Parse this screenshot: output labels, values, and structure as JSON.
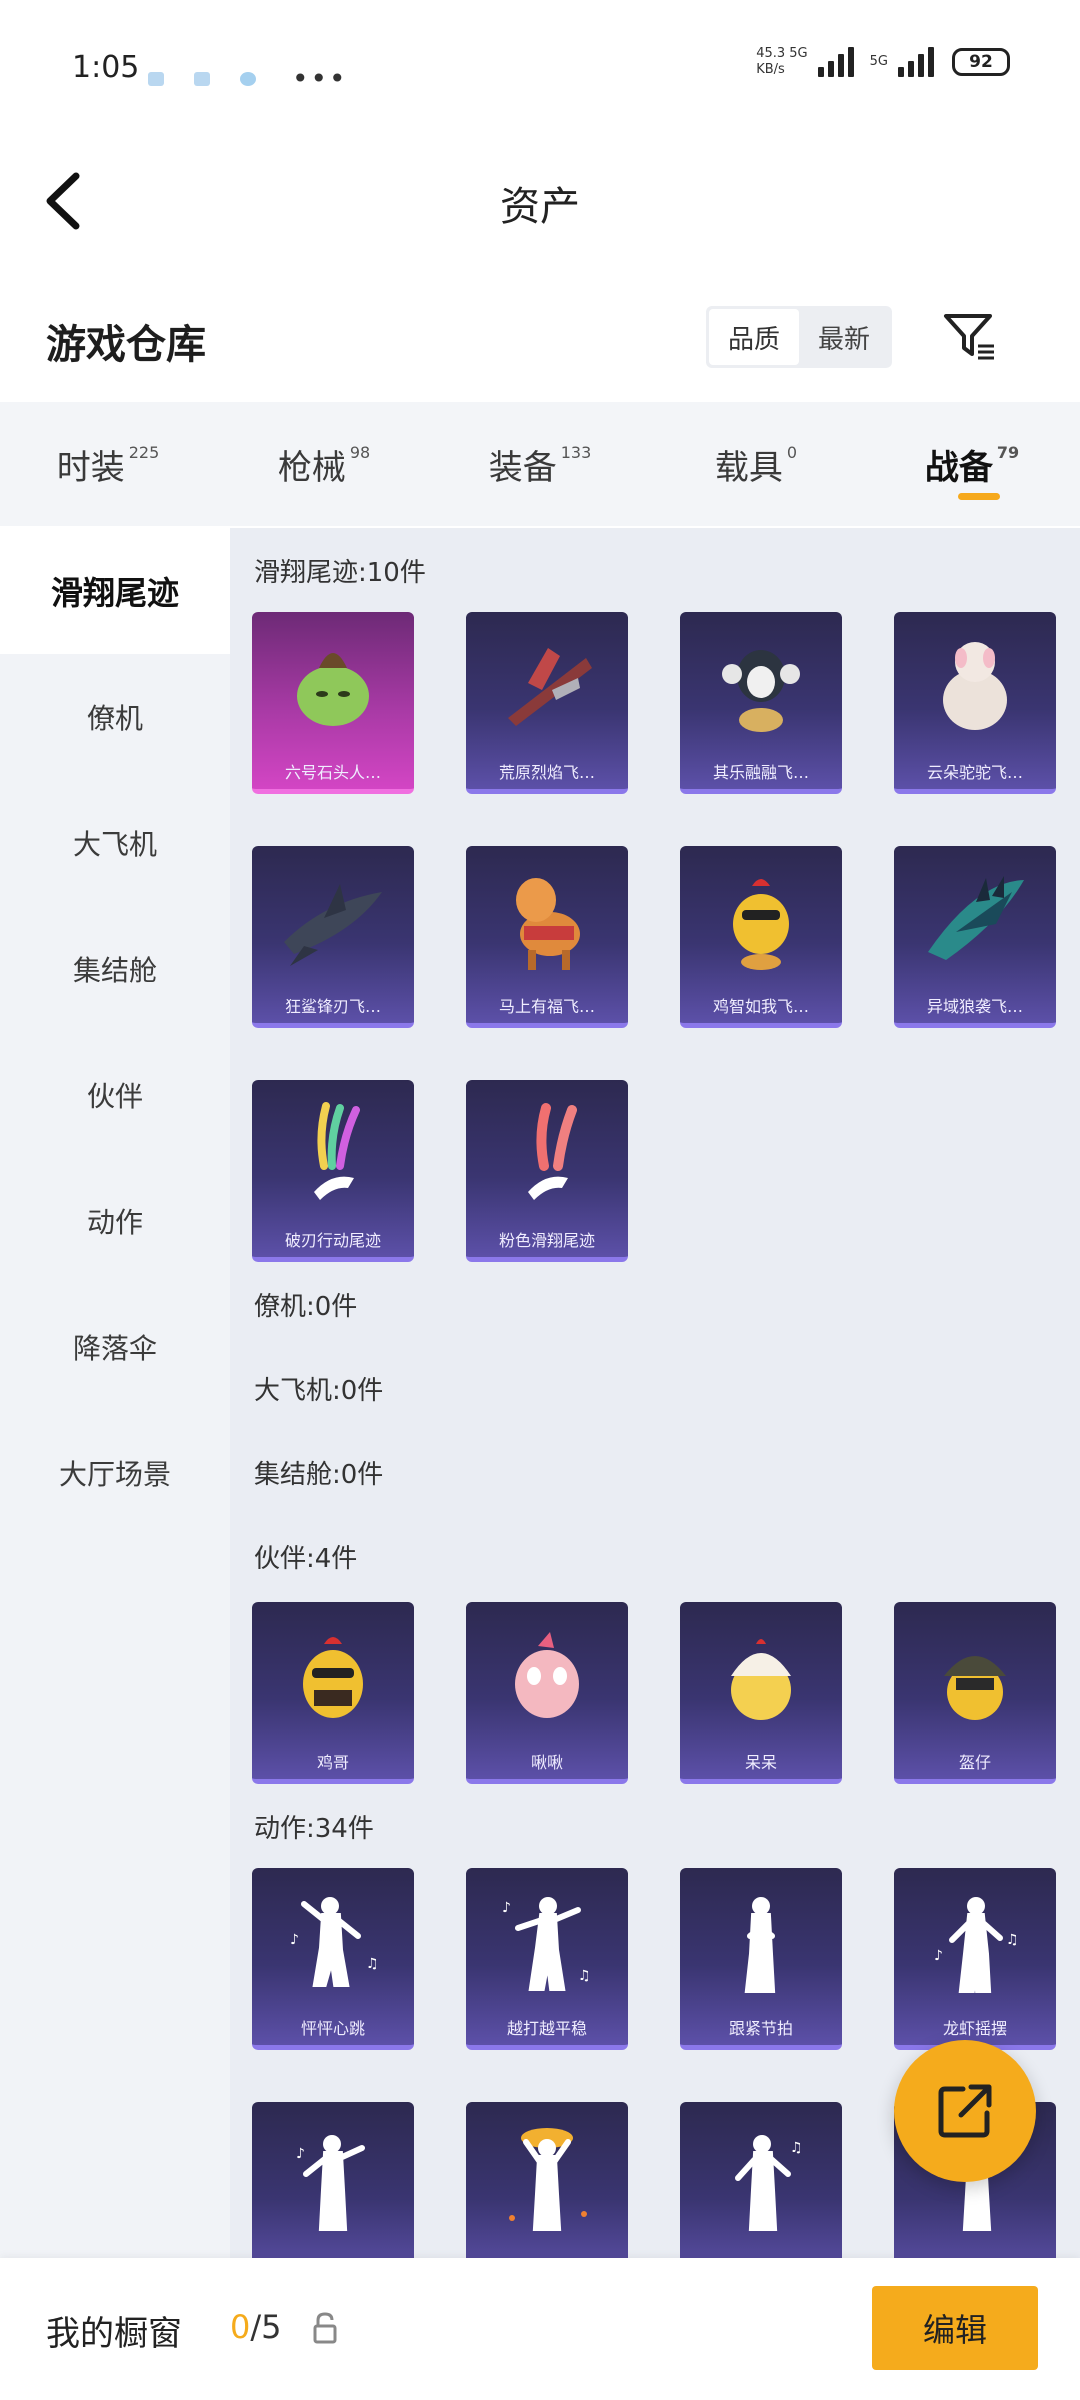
{
  "status_bar": {
    "time": "1:05",
    "speed_value": "45.3 5G",
    "speed_unit": "KB/s",
    "network": "5G",
    "battery": "92"
  },
  "header": {
    "title": "资产"
  },
  "warehouse": {
    "title": "游戏仓库",
    "sort_options": [
      "品质",
      "最新"
    ],
    "active_sort": "品质"
  },
  "tabs": [
    {
      "label": "时装",
      "count": "225"
    },
    {
      "label": "枪械",
      "count": "98"
    },
    {
      "label": "装备",
      "count": "133"
    },
    {
      "label": "载具",
      "count": "0"
    },
    {
      "label": "战备",
      "count": "79"
    }
  ],
  "active_tab": "战备",
  "sidenav": [
    "滑翔尾迹",
    "僚机",
    "大飞机",
    "集结舱",
    "伙伴",
    "动作",
    "降落伞",
    "大厅场景"
  ],
  "sections": {
    "trail": {
      "title": "滑翔尾迹:10件",
      "items": [
        "六号石头人…",
        "荒原烈焰飞…",
        "其乐融融飞…",
        "云朵驼驼飞…",
        "狂鲨锋刃飞…",
        "马上有福飞…",
        "鸡智如我飞…",
        "异域狼袭飞…",
        "破刃行动尾迹",
        "粉色滑翔尾迹"
      ]
    },
    "wingman": {
      "title": "僚机:0件"
    },
    "plane": {
      "title": "大飞机:0件"
    },
    "pod": {
      "title": "集结舱:0件"
    },
    "partner": {
      "title": "伙伴:4件",
      "items": [
        "鸡哥",
        "啾啾",
        "呆呆",
        "盔仔"
      ]
    },
    "emote": {
      "title": "动作:34件",
      "items": [
        "怦怦心跳",
        "越打越平稳",
        "跟紧节拍",
        "龙虾摇摆",
        "",
        "",
        "",
        ""
      ]
    }
  },
  "bottom_bar": {
    "label": "我的橱窗",
    "current": "0",
    "total": "/5",
    "edit": "编辑"
  },
  "colors": {
    "accent": "#f5ab1c",
    "card_purple": "#3a3571",
    "card_pink": "#a83aa5"
  }
}
